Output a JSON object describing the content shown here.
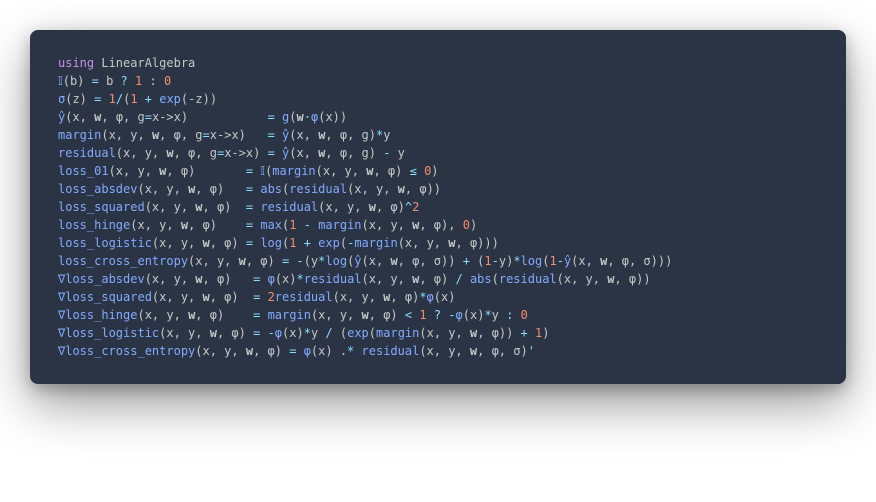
{
  "language": "julia",
  "lines": {
    "l1_kw": "using",
    "l1_mod": " LinearAlgebra",
    "blank": "",
    "l2_fn": "𝕀",
    "l2_rest_a": "(b) ",
    "l2_eq": "=",
    "l2_rest_b": " b ",
    "l2_q": "?",
    "l2_sp1": " ",
    "l2_n1": "1",
    "l2_sp2": " ",
    "l2_colon": ":",
    "l2_sp3": " ",
    "l2_n0": "0",
    "l3_fn": "σ",
    "l3_a": "(z) ",
    "l3_eq": "=",
    "l3_sp": " ",
    "l3_n1": "1",
    "l3_div": "/",
    "l3_op": "(",
    "l3_n1b": "1",
    "l3_plus": " + ",
    "l3_exp": "exp",
    "l3_op2": "(",
    "l3_minus": "-",
    "l3_z": "z))",
    "l4_fn": "ŷ",
    "l4_args": "(x, ",
    "l4_w": "w",
    "l4_args2": ", φ, g",
    "l4_eq1": "=",
    "l4_lam": "x->x)",
    "l4_pad": "           ",
    "l4_eq": "=",
    "l4_sp": " ",
    "l4_g": "g",
    "l4_par": "(",
    "l4_wb": "w",
    "l4_dot": "⋅",
    "l4_phi": "φ",
    "l4_px": "(x))",
    "l5_fn": "margin",
    "l5_args": "(x, y, ",
    "l5_w": "w",
    "l5_args2": ", φ, g",
    "l5_eq1": "=",
    "l5_lam": "x->x)",
    "l5_pad": "   ",
    "l5_eq": "=",
    "l5_sp": " ",
    "l5_yhat": "ŷ",
    "l5_rest": "(x, ",
    "l5_wb": "w",
    "l5_rest2": ", φ, g)",
    "l5_mul": "*",
    "l5_y": "y",
    "l6_fn": "residual",
    "l6_args": "(x, y, ",
    "l6_w": "w",
    "l6_args2": ", φ, g",
    "l6_eq1": "=",
    "l6_lam": "x->x)",
    "l6_pad": " ",
    "l6_eq": "=",
    "l6_sp": " ",
    "l6_yhat": "ŷ",
    "l6_rest": "(x, ",
    "l6_wb": "w",
    "l6_rest2": ", φ, g) ",
    "l6_minus": "-",
    "l6_y": " y",
    "l7_fn": "loss_01",
    "l7_args": "(x, y, ",
    "l7_w": "w",
    "l7_args2": ", φ)",
    "l7_pad": "       ",
    "l7_eq": "=",
    "l7_sp": " ",
    "l7_ind": "𝕀",
    "l7_op": "(",
    "l7_mar": "margin",
    "l7_rest": "(x, y, ",
    "l7_wb": "w",
    "l7_rest2": ", φ) ",
    "l7_le": "≤",
    "l7_sp2": " ",
    "l7_n0": "0",
    "l7_cp": ")",
    "l8_fn": "loss_absdev",
    "l8_args": "(x, y, ",
    "l8_w": "w",
    "l8_args2": ", φ)",
    "l8_pad": "   ",
    "l8_eq": "=",
    "l8_sp": " ",
    "l8_abs": "abs",
    "l8_op": "(",
    "l8_res": "residual",
    "l8_rest": "(x, y, ",
    "l8_wb": "w",
    "l8_rest2": ", φ))",
    "l9_fn": "loss_squared",
    "l9_args": "(x, y, ",
    "l9_w": "w",
    "l9_args2": ", φ)",
    "l9_pad": "  ",
    "l9_eq": "=",
    "l9_sp": " ",
    "l9_res": "residual",
    "l9_rest": "(x, y, ",
    "l9_wb": "w",
    "l9_rest2": ", φ)",
    "l9_pow": "^",
    "l9_n2": "2",
    "l10_fn": "loss_hinge",
    "l10_args": "(x, y, ",
    "l10_w": "w",
    "l10_args2": ", φ)",
    "l10_pad": "    ",
    "l10_eq": "=",
    "l10_sp": " ",
    "l10_max": "max",
    "l10_op": "(",
    "l10_n1": "1",
    "l10_minus": " - ",
    "l10_mar": "margin",
    "l10_rest": "(x, y, ",
    "l10_wb": "w",
    "l10_rest2": ", φ), ",
    "l10_n0": "0",
    "l10_cp": ")",
    "l11_fn": "loss_logistic",
    "l11_args": "(x, y, ",
    "l11_w": "w",
    "l11_args2": ", φ) ",
    "l11_eq": "=",
    "l11_sp": " ",
    "l11_log": "log",
    "l11_op": "(",
    "l11_n1": "1",
    "l11_plus": " + ",
    "l11_exp": "exp",
    "l11_op2": "(",
    "l11_minus": "-",
    "l11_mar": "margin",
    "l11_rest": "(x, y, ",
    "l11_wb": "w",
    "l11_rest2": ", φ)))",
    "l12_fn": "loss_cross_entropy",
    "l12_args": "(x, y, ",
    "l12_w": "w",
    "l12_args2": ", φ) ",
    "l12_eq": "=",
    "l12_sp": " ",
    "l12_minus": "-",
    "l12_op": "(y",
    "l12_mul": "*",
    "l12_log": "log",
    "l12_op2": "(",
    "l12_yhat": "ŷ",
    "l12_rest": "(x, ",
    "l12_wb": "w",
    "l12_rest2": ", φ, σ)) ",
    "l12_plus": "+",
    "l12_sp2": " (",
    "l12_n1": "1",
    "l12_my": "-",
    "l12_y": "y)",
    "l12_mul2": "*",
    "l12_log2": "log",
    "l12_op3": "(",
    "l12_n1b": "1",
    "l12_minus2": "-",
    "l12_yhat2": "ŷ",
    "l12_rest3": "(x, ",
    "l12_wb2": "w",
    "l12_rest4": ", φ, σ)))",
    "l13_fn": "∇loss_absdev",
    "l13_args": "(x, y, ",
    "l13_w": "w",
    "l13_args2": ", φ)",
    "l13_pad": "   ",
    "l13_eq": "=",
    "l13_sp": " ",
    "l13_phi": "φ",
    "l13_px": "(x)",
    "l13_mul": "*",
    "l13_res": "residual",
    "l13_rest": "(x, y, ",
    "l13_wb": "w",
    "l13_rest2": ", φ) ",
    "l13_div": "/",
    "l13_sp2": " ",
    "l13_abs": "abs",
    "l13_op": "(",
    "l13_res2": "residual",
    "l13_rest3": "(x, y, ",
    "l13_wb2": "w",
    "l13_rest4": ", φ))",
    "l14_fn": "∇loss_squared",
    "l14_args": "(x, y, ",
    "l14_w": "w",
    "l14_args2": ", φ)",
    "l14_pad": "  ",
    "l14_eq": "=",
    "l14_sp": " ",
    "l14_n2": "2",
    "l14_res": "residual",
    "l14_rest": "(x, y, ",
    "l14_wb": "w",
    "l14_rest2": ", φ)",
    "l14_mul": "*",
    "l14_phi": "φ",
    "l14_px": "(x)",
    "l15_fn": "∇loss_hinge",
    "l15_args": "(x, y, ",
    "l15_w": "w",
    "l15_args2": ", φ)",
    "l15_pad": "    ",
    "l15_eq": "=",
    "l15_sp": " ",
    "l15_mar": "margin",
    "l15_rest": "(x, y, ",
    "l15_wb": "w",
    "l15_rest2": ", φ) ",
    "l15_lt": "<",
    "l15_sp2": " ",
    "l15_n1": "1",
    "l15_sp3": " ",
    "l15_q": "?",
    "l15_sp4": " ",
    "l15_minus": "-",
    "l15_phi": "φ",
    "l15_px": "(x)",
    "l15_mul": "*",
    "l15_y": "y ",
    "l15_colon": ":",
    "l15_sp5": " ",
    "l15_n0": "0",
    "l16_fn": "∇loss_logistic",
    "l16_args": "(x, y, ",
    "l16_w": "w",
    "l16_args2": ", φ) ",
    "l16_eq": "=",
    "l16_sp": " ",
    "l16_minus": "-",
    "l16_phi": "φ",
    "l16_px": "(x)",
    "l16_mul": "*",
    "l16_y": "y ",
    "l16_div": "/",
    "l16_sp2": " (",
    "l16_exp": "exp",
    "l16_op": "(",
    "l16_mar": "margin",
    "l16_rest": "(x, y, ",
    "l16_wb": "w",
    "l16_rest2": ", φ)) ",
    "l16_plus": "+",
    "l16_sp3": " ",
    "l16_n1": "1",
    "l16_cp": ")",
    "l17_fn": "∇loss_cross_entropy",
    "l17_args": "(x, y, ",
    "l17_w": "w",
    "l17_args2": ", φ) ",
    "l17_eq": "=",
    "l17_sp": " ",
    "l17_phi": "φ",
    "l17_px": "(x) ",
    "l17_dot": ".*",
    "l17_sp2": " ",
    "l17_res": "residual",
    "l17_rest": "(x, y, ",
    "l17_wb": "w",
    "l17_rest2": ", φ, σ)",
    "l17_t": "'"
  }
}
